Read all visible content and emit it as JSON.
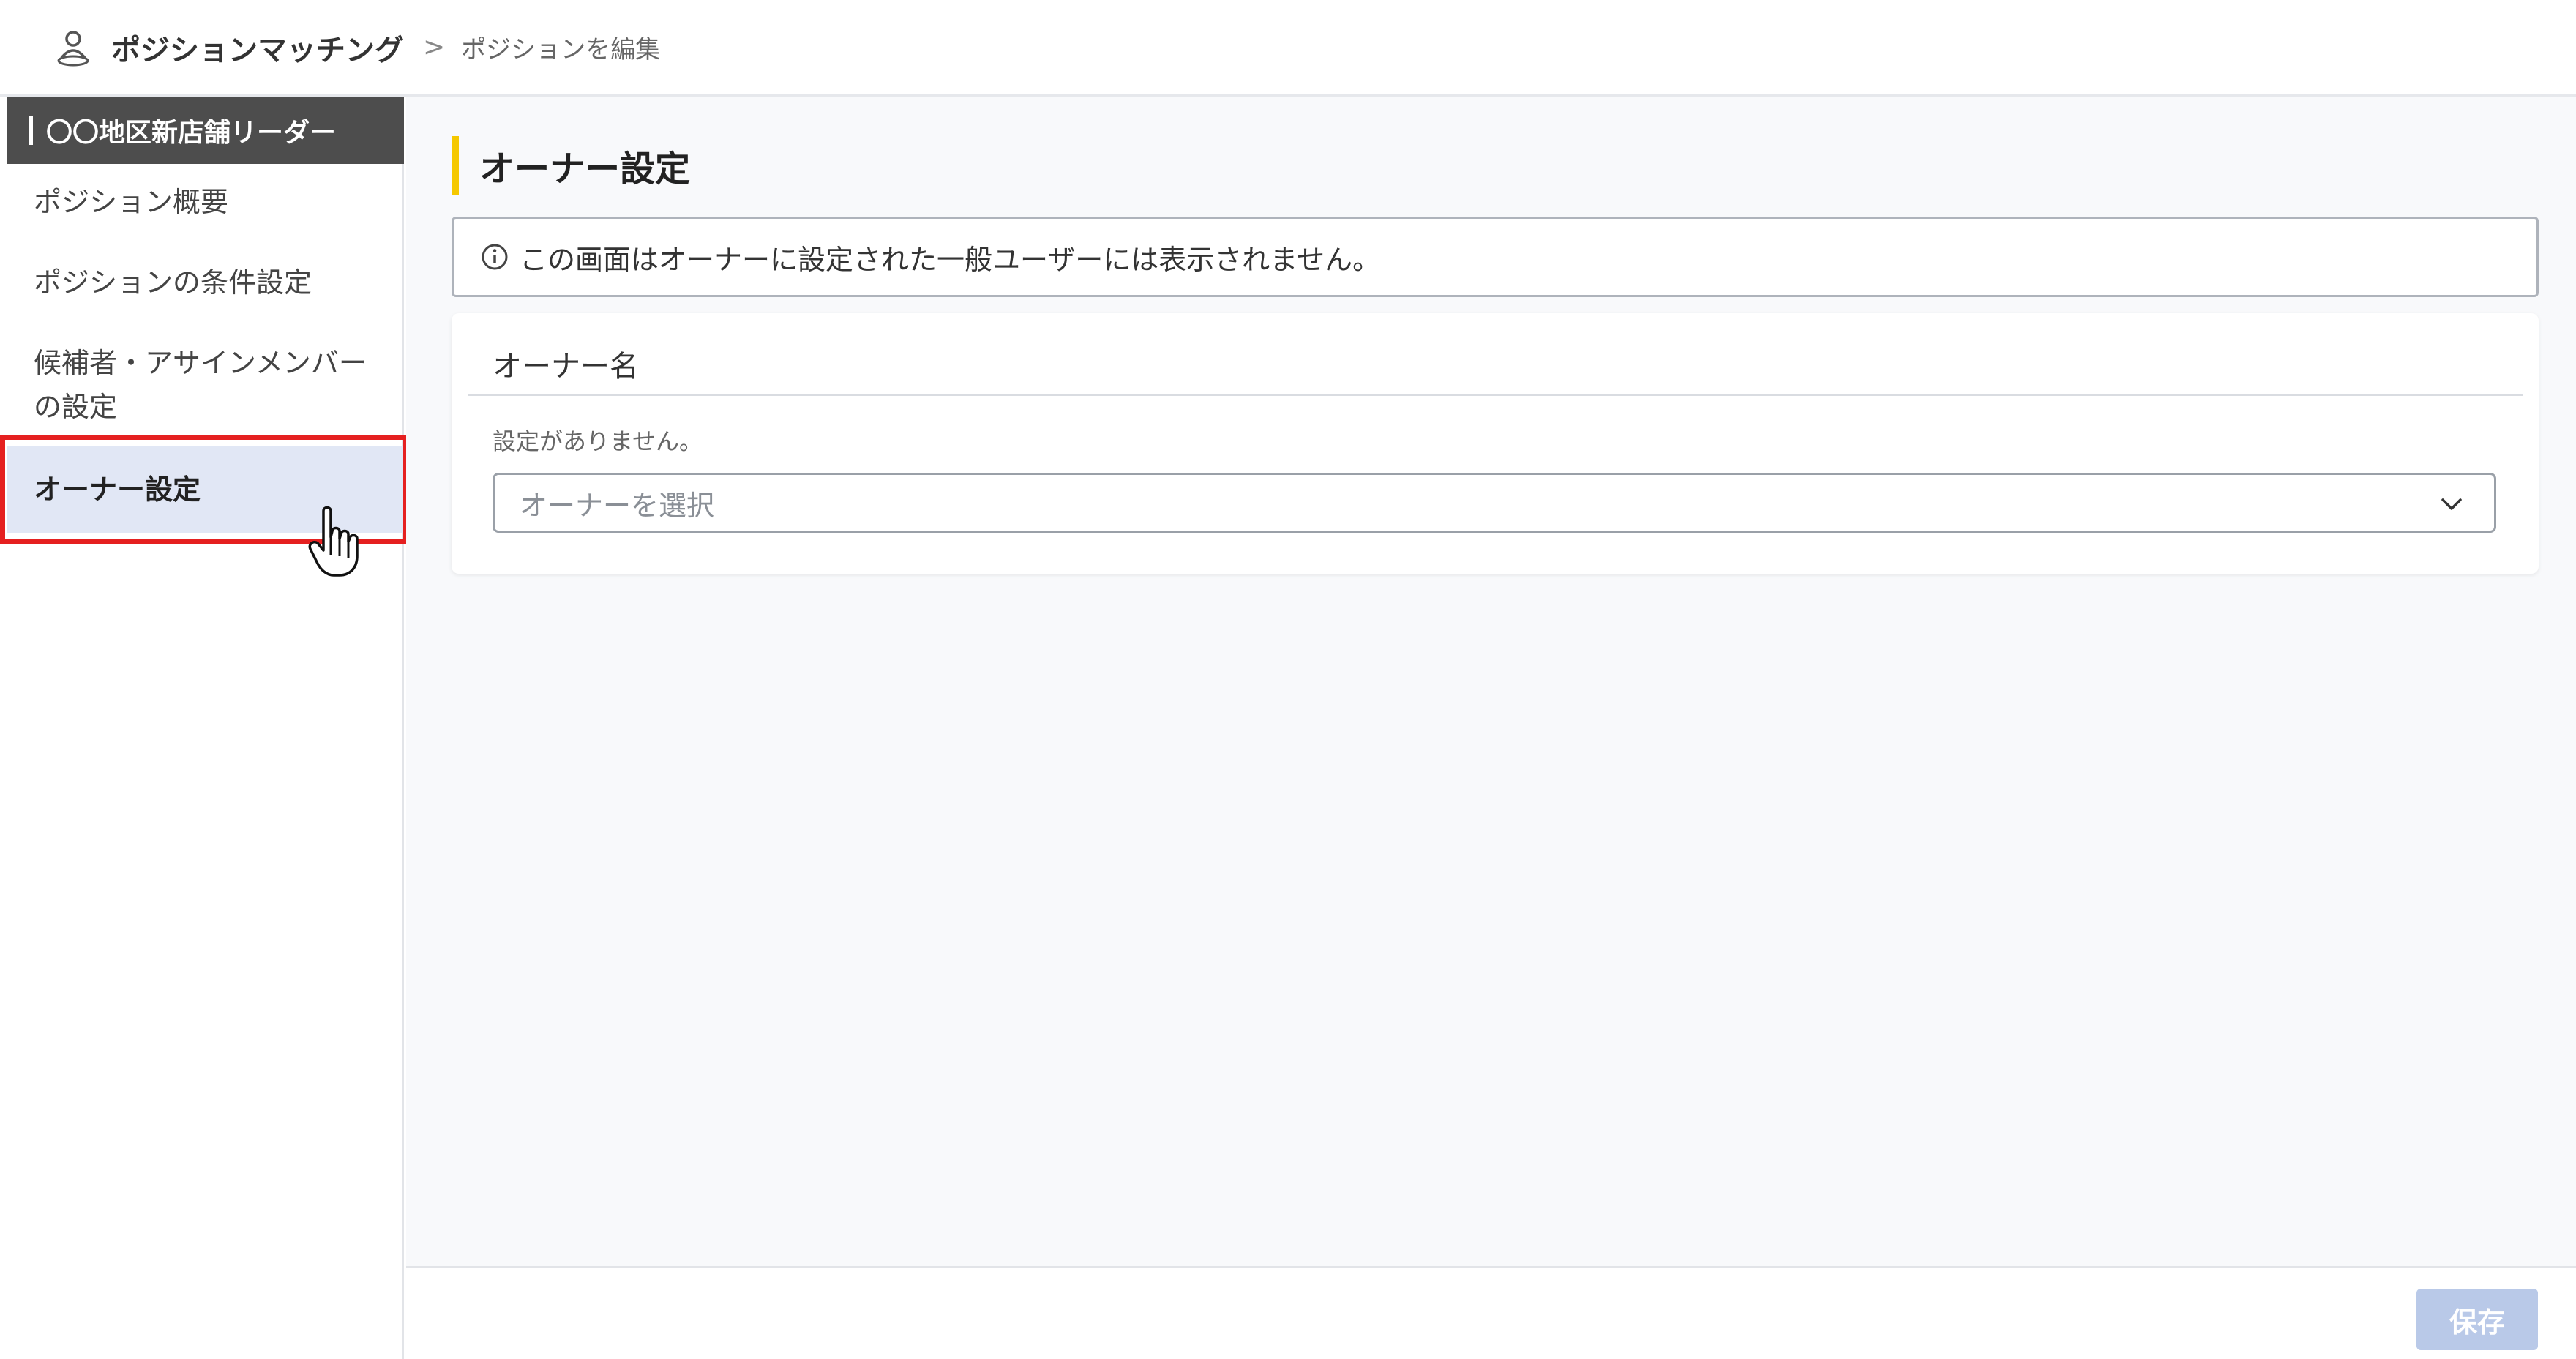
{
  "header": {
    "app_icon": "person-pin-icon",
    "app_name": "ポジションマッチング",
    "breadcrumb_separator": ">",
    "breadcrumb_current": "ポジションを編集"
  },
  "sidebar": {
    "section_title": "〇〇地区新店舗リーダー",
    "items": [
      {
        "label": "ポジション概要",
        "active": false
      },
      {
        "label": "ポジションの条件設定",
        "active": false
      },
      {
        "label": "候補者・アサインメンバーの設定",
        "active": false
      },
      {
        "label": "オーナー設定",
        "active": true
      }
    ]
  },
  "main": {
    "title": "オーナー設定",
    "notice_icon": "info-icon",
    "notice_text": "この画面はオーナーに設定された一般ユーザーには表示されません。",
    "card": {
      "title": "オーナー名",
      "note": "設定がありません。",
      "select_placeholder": "オーナーを選択"
    }
  },
  "footer": {
    "save_label": "保存"
  },
  "colors": {
    "accent_bar": "#f5c800",
    "sidebar_header_bg": "#4d4d4d",
    "active_item_bg": "#e1e7f5",
    "highlight_border": "#e52020",
    "save_button_disabled": "#b9c9e8"
  }
}
